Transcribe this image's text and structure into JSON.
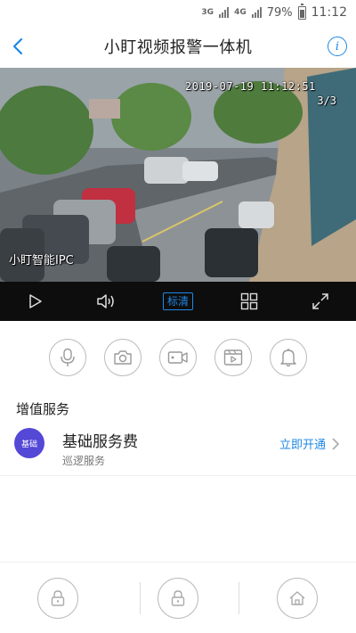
{
  "status_bar": {
    "network1": "3G",
    "network2": "4G",
    "battery": "79%",
    "time": "11:12"
  },
  "header": {
    "title": "小盯视频报警一体机",
    "info_label": "i"
  },
  "video": {
    "timestamp": "2019-07-19 11:12:51",
    "page": "3/3",
    "camera_name": "小盯智能IPC"
  },
  "controls": {
    "quality_label": "标清"
  },
  "actions": [
    "microphone-icon",
    "camera-icon",
    "video-record-icon",
    "playback-icon",
    "bell-icon"
  ],
  "section": {
    "title": "增值服务"
  },
  "service": {
    "icon_label": "基础",
    "name": "基础服务费",
    "subtitle": "巡逻服务",
    "action": "立即开通"
  },
  "bottom": [
    "lock-icon",
    "lock-icon",
    "home-icon"
  ],
  "colors": {
    "accent": "#1e88e5",
    "service_icon": "#5448d6",
    "control_bar": "#0d0d0d"
  }
}
